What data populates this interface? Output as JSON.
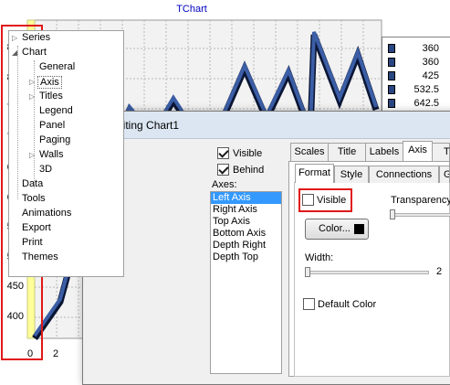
{
  "chart": {
    "title": "TChart",
    "y_ticks": [
      "850",
      "800",
      "750",
      "700",
      "650",
      "600",
      "550",
      "500",
      "450",
      "400"
    ],
    "x_ticks": [
      "0",
      "2"
    ],
    "legend": [
      "360",
      "360",
      "425",
      "532.5",
      "642.5",
      "635"
    ],
    "colors": {
      "series_fill": "#2a4680",
      "highlight": "#e01818",
      "axis_highlight": "#ffff99"
    }
  },
  "dialog": {
    "title": "Editing Chart1",
    "tree": {
      "series": "Series",
      "chart": "Chart",
      "general": "General",
      "axis": "Axis",
      "titles": "Titles",
      "legend": "Legend",
      "panel": "Panel",
      "paging": "Paging",
      "walls": "Walls",
      "three_d": "3D",
      "data": "Data",
      "tools": "Tools",
      "animations": "Animations",
      "export": "Export",
      "print": "Print",
      "themes": "Themes"
    },
    "visible_label": "Visible",
    "behind_label": "Behind",
    "axes_label": "Axes:",
    "axes_items": [
      "Left Axis",
      "Right Axis",
      "Top Axis",
      "Bottom Axis",
      "Depth Right",
      "Depth Top"
    ],
    "tabs": [
      "Scales",
      "Title",
      "Labels",
      "Axis",
      "T"
    ],
    "subtabs": [
      "Format",
      "Style",
      "Connections",
      "G"
    ],
    "format": {
      "visible_label": "Visible",
      "transparency_label": "Transparency",
      "color_button": "Color...",
      "width_label": "Width:",
      "width_value": "2",
      "default_color_label": "Default Color"
    }
  }
}
